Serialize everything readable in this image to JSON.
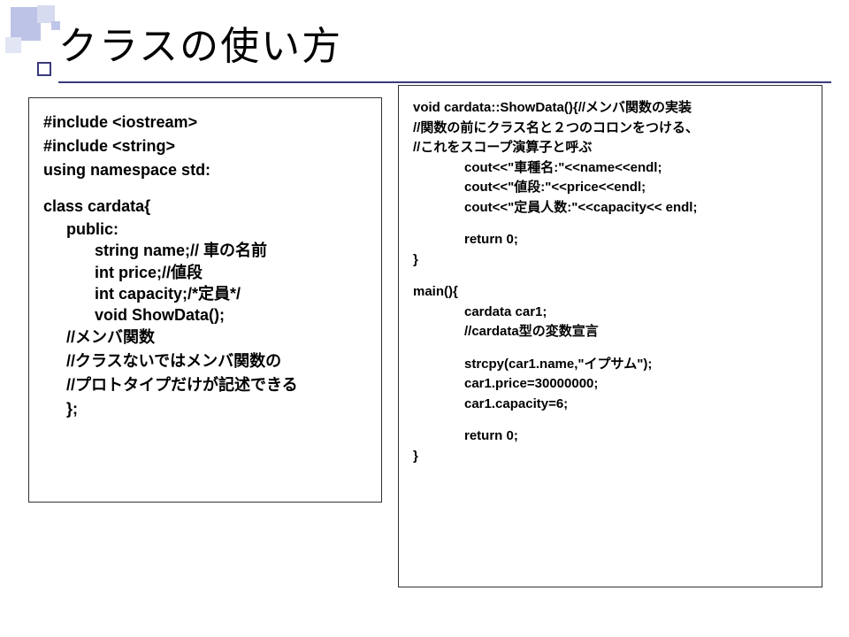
{
  "title": "クラスの使い方",
  "left": {
    "l1": "#include <iostream>",
    "l2": "#include <string>",
    "l3": "using namespace std:",
    "l4": "class cardata{",
    "l5": "public:",
    "l6": "string name;// 車の名前",
    "l7": "int price;//値段",
    "l8": "int capacity;/*定員*/",
    "l9": "void ShowData();",
    "l10": "//メンバ関数",
    "l11": "//クラスないではメンバ関数の",
    "l12": "//プロトタイプだけが記述できる",
    "l13": "};"
  },
  "right": {
    "r1": "void cardata::ShowData(){//メンバ関数の実装",
    "r2": "//関数の前にクラス名と２つのコロンをつける、",
    "r3": "//これをスコープ演算子と呼ぶ",
    "r4": "cout<<\"車種名:\"<<name<<endl;",
    "r5": "cout<<\"値段:\"<<price<<endl;",
    "r6": "cout<<\"定員人数:\"<<capacity<< endl;",
    "r7": "return 0;",
    "r8": "}",
    "r9": "main(){",
    "r10": "cardata car1;",
    "r11": "//cardata型の変数宣言",
    "r12": "strcpy(car1.name,\"イプサム\");",
    "r13": "car1.price=30000000;",
    "r14": "car1.capacity=6;",
    "r15": "return 0;",
    "r16": "}"
  }
}
